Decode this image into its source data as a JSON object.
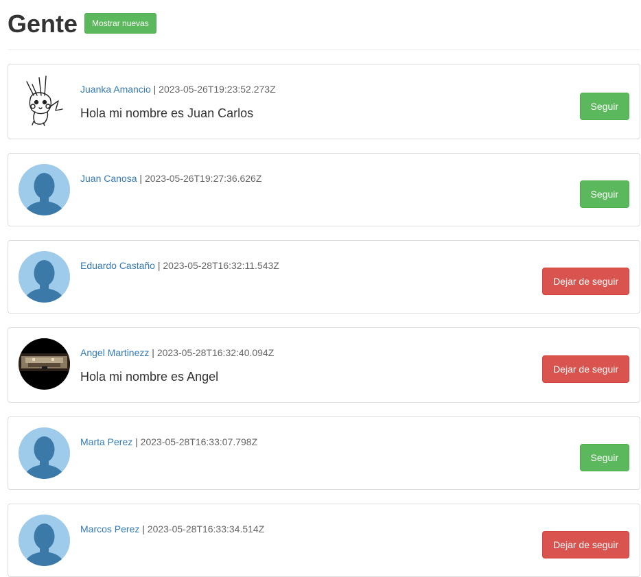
{
  "header": {
    "title": "Gente",
    "new_button_label": "Mostrar nuevas"
  },
  "users": [
    {
      "name": "Juanka Amancio",
      "separator": "|",
      "date": "2023-05-26T19:23:52.273Z",
      "text": "Hola mi nombre es Juan Carlos",
      "avatar": "pikachu-sketch",
      "action_label": "Seguir"
    },
    {
      "name": "Juan Canosa",
      "separator": "|",
      "date": "2023-05-26T19:27:36.626Z",
      "text": "",
      "avatar": "default-avatar",
      "action_label": "Seguir"
    },
    {
      "name": "Eduardo Castaño",
      "separator": "|",
      "date": "2023-05-28T16:32:11.543Z",
      "text": "",
      "avatar": "default-avatar",
      "action_label": "Dejar de seguir"
    },
    {
      "name": "Angel Martinezz",
      "separator": "|",
      "date": "2023-05-28T16:32:40.094Z",
      "text": "Hola mi nombre es Angel",
      "avatar": "photo-avatar",
      "action_label": "Dejar de seguir"
    },
    {
      "name": "Marta Perez",
      "separator": "|",
      "date": "2023-05-28T16:33:07.798Z",
      "text": "",
      "avatar": "default-avatar",
      "action_label": "Seguir"
    },
    {
      "name": "Marcos Perez",
      "separator": "|",
      "date": "2023-05-28T16:33:34.514Z",
      "text": "",
      "avatar": "default-avatar",
      "action_label": "Dejar de seguir"
    }
  ],
  "colors": {
    "follow": "#5cb85c",
    "unfollow": "#d9534f",
    "link": "#337ab7",
    "avatar_bg": "#9fcbea",
    "avatar_figure": "#3a79a8"
  }
}
